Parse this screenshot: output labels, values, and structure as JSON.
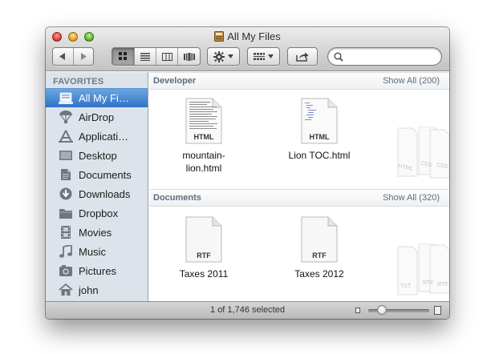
{
  "window": {
    "title": "All My Files",
    "title_icon": "all-my-files-icon"
  },
  "toolbar": {
    "back_icon": "back-arrow-icon",
    "forward_icon": "forward-arrow-icon",
    "view_modes": [
      "icon-view",
      "list-view",
      "column-view",
      "cover-flow-view"
    ],
    "active_view": "icon-view",
    "action_icon": "gear-icon",
    "arrange_icon": "arrange-icon",
    "share_icon": "share-icon",
    "search": {
      "value": "",
      "placeholder": ""
    }
  },
  "sidebar": {
    "heading": "FAVORITES",
    "items": [
      {
        "label": "All My Fi…",
        "icon": "all-my-files-icon",
        "selected": true
      },
      {
        "label": "AirDrop",
        "icon": "airdrop-icon"
      },
      {
        "label": "Applicati…",
        "icon": "applications-icon"
      },
      {
        "label": "Desktop",
        "icon": "desktop-icon"
      },
      {
        "label": "Documents",
        "icon": "documents-icon"
      },
      {
        "label": "Downloads",
        "icon": "downloads-icon"
      },
      {
        "label": "Dropbox",
        "icon": "folder-icon"
      },
      {
        "label": "Movies",
        "icon": "movies-icon"
      },
      {
        "label": "Music",
        "icon": "music-icon"
      },
      {
        "label": "Pictures",
        "icon": "pictures-icon"
      },
      {
        "label": "john",
        "icon": "home-icon"
      }
    ]
  },
  "sections": [
    {
      "title": "Developer",
      "show_all": "Show All (200)",
      "files": [
        {
          "name": "mountain-\nlion.html",
          "badge": "HTML",
          "icon": "html-document-icon"
        },
        {
          "name": "Lion TOC.html",
          "badge": "HTML",
          "icon": "html-document-icon"
        }
      ],
      "stack_badges": [
        "HTML",
        "CSS",
        "CSS"
      ]
    },
    {
      "title": "Documents",
      "show_all": "Show All (320)",
      "files": [
        {
          "name": "Taxes 2011",
          "badge": "RTF",
          "icon": "rtf-document-icon"
        },
        {
          "name": "Taxes 2012",
          "badge": "RTF",
          "icon": "rtf-document-icon"
        }
      ],
      "stack_badges": [
        "TXT",
        "RTF",
        "RTF"
      ]
    }
  ],
  "status": {
    "text": "1 of 1,746 selected",
    "icon_size_level": 0.25
  },
  "colors": {
    "selection": "#3a7ccc",
    "sidebar_bg": "#dde3ea",
    "section_text": "#5f6d7e"
  }
}
